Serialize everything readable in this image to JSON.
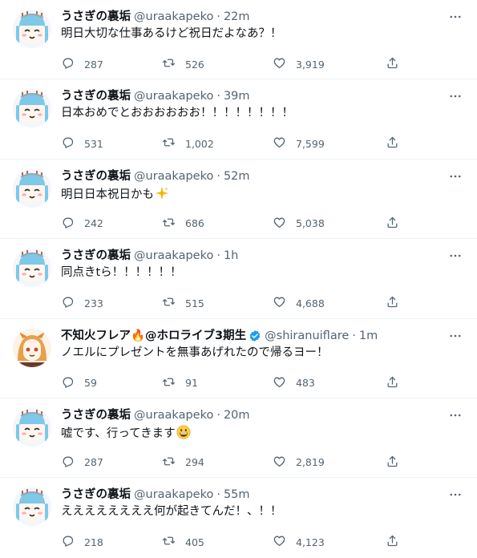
{
  "tweets": [
    {
      "name": "うさぎの裏垢",
      "handle": "@uraakapeko",
      "sep": "·",
      "time": "22m",
      "text": "明日大切な仕事あるけど祝日だよなあ？！",
      "replies": "287",
      "retweets": "526",
      "likes": "3,919",
      "avatar": "usagi",
      "emoji": ""
    },
    {
      "name": "うさぎの裏垢",
      "handle": "@uraakapeko",
      "sep": "·",
      "time": "39m",
      "text": "日本おめでとおおおおおお！！！！！！！！",
      "replies": "531",
      "retweets": "1,002",
      "likes": "7,599",
      "avatar": "usagi",
      "emoji": ""
    },
    {
      "name": "うさぎの裏垢",
      "handle": "@uraakapeko",
      "sep": "·",
      "time": "52m",
      "text": "明日日本祝日かも",
      "replies": "242",
      "retweets": "686",
      "likes": "5,038",
      "avatar": "usagi",
      "emoji": "sparkles"
    },
    {
      "name": "うさぎの裏垢",
      "handle": "@uraakapeko",
      "sep": "·",
      "time": "1h",
      "text": "同点きtら！！！！！！",
      "replies": "233",
      "retweets": "515",
      "likes": "4,688",
      "avatar": "usagi",
      "emoji": ""
    },
    {
      "name": "不知火フレア🔥@ホロライブ3期生",
      "handle": "@shiranuiflare",
      "sep": "·",
      "time": "1m",
      "text": "ノエルにプレゼントを無事あげれたので帰るヨー！",
      "replies": "59",
      "retweets": "91",
      "likes": "483",
      "avatar": "flare",
      "verified": true,
      "emoji": ""
    },
    {
      "name": "うさぎの裏垢",
      "handle": "@uraakapeko",
      "sep": "·",
      "time": "20m",
      "text": "嘘です、行ってきます",
      "replies": "287",
      "retweets": "294",
      "likes": "2,819",
      "avatar": "usagi",
      "emoji": "grin"
    },
    {
      "name": "うさぎの裏垢",
      "handle": "@uraakapeko",
      "sep": "·",
      "time": "55m",
      "text": "ええええええええ何が起きてんだ！、！！",
      "replies": "218",
      "retweets": "405",
      "likes": "4,123",
      "avatar": "usagi",
      "emoji": ""
    }
  ],
  "colors": {
    "text": "#0f1419",
    "muted": "#536471",
    "divider": "#eff3f4",
    "verified": "#1d9bf0"
  },
  "icons": [
    "reply-icon",
    "retweet-icon",
    "like-icon",
    "share-icon",
    "more-icon",
    "verified-icon"
  ]
}
